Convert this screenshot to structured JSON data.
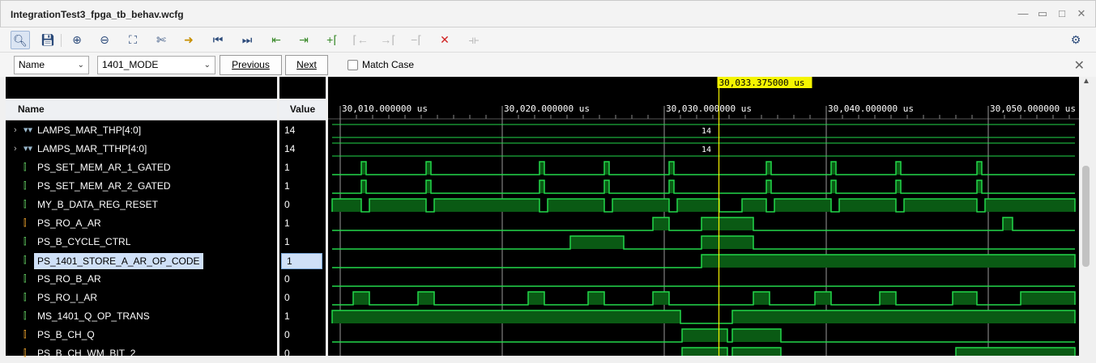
{
  "window": {
    "title": "IntegrationTest3_fpga_tb_behav.wcfg"
  },
  "search": {
    "field": "Name",
    "value": "1401_MODE",
    "previous_label": "Previous",
    "next_label": "Next",
    "match_case_label": "Match Case"
  },
  "columns": {
    "name": "Name",
    "value": "Value"
  },
  "signals": [
    {
      "name": "LAMPS_MAR_THP[4:0]",
      "value": "14",
      "type": "bus"
    },
    {
      "name": "LAMPS_MAR_TTHP[4:0]",
      "value": "14",
      "type": "bus"
    },
    {
      "name": "PS_SET_MEM_AR_1_GATED",
      "value": "1",
      "type": "bit"
    },
    {
      "name": "PS_SET_MEM_AR_2_GATED",
      "value": "1",
      "type": "bit"
    },
    {
      "name": "MY_B_DATA_REG_RESET",
      "value": "0",
      "type": "bit"
    },
    {
      "name": "PS_RO_A_AR",
      "value": "1",
      "type": "bit-orange"
    },
    {
      "name": "PS_B_CYCLE_CTRL",
      "value": "1",
      "type": "bit"
    },
    {
      "name": "PS_1401_STORE_A_AR_OP_CODE",
      "value": "1",
      "type": "bit",
      "selected": true
    },
    {
      "name": "PS_RO_B_AR",
      "value": "0",
      "type": "bit"
    },
    {
      "name": "PS_RO_I_AR",
      "value": "0",
      "type": "bit"
    },
    {
      "name": "MS_1401_Q_OP_TRANS",
      "value": "1",
      "type": "bit"
    },
    {
      "name": "PS_B_CH_Q",
      "value": "0",
      "type": "bit-orange"
    },
    {
      "name": "PS_B_CH_WM_BIT_2",
      "value": "0",
      "type": "bit-orange"
    }
  ],
  "timeline": {
    "cursor_label": "30,033.375000 us",
    "cursor_time_us": 30033.375,
    "ticks": [
      {
        "t": 30010,
        "label": "30,010.000000 us"
      },
      {
        "t": 30020,
        "label": "30,020.000000 us"
      },
      {
        "t": 30030,
        "label": "30,030.000000 us"
      },
      {
        "t": 30040,
        "label": "30,040.000000 us"
      },
      {
        "t": 30050,
        "label": "30,050.000000 us"
      }
    ],
    "bus_values": [
      "14",
      "14"
    ]
  },
  "waves": {
    "PS_SET_MEM_AR_1_GATED": [
      [
        30011.3,
        30011.6
      ],
      [
        30015.3,
        30015.6
      ],
      [
        30022.3,
        30022.6
      ],
      [
        30026.3,
        30026.6
      ],
      [
        30030.3,
        30030.6
      ],
      [
        30036.3,
        30036.6
      ],
      [
        30040.3,
        30040.6
      ],
      [
        30044.3,
        30044.6
      ],
      [
        30049.3,
        30049.6
      ]
    ],
    "PS_SET_MEM_AR_2_GATED": [
      [
        30011.3,
        30011.6
      ],
      [
        30015.3,
        30015.6
      ],
      [
        30022.3,
        30022.6
      ],
      [
        30026.3,
        30026.6
      ],
      [
        30030.3,
        30030.6
      ],
      [
        30036.3,
        30036.6
      ],
      [
        30040.3,
        30040.6
      ],
      [
        30044.3,
        30044.6
      ],
      [
        30049.3,
        30049.6
      ]
    ],
    "MY_B_DATA_REG_RESET": [
      [
        30005.2,
        30011.3
      ],
      [
        30011.8,
        30015.3
      ],
      [
        30015.8,
        30022.3
      ],
      [
        30022.8,
        30026.3
      ],
      [
        30026.8,
        30030.3
      ],
      [
        30030.8,
        30033.4
      ],
      [
        30034.8,
        30036.3
      ],
      [
        30036.8,
        30040.3
      ],
      [
        30040.8,
        30044.3
      ],
      [
        30044.8,
        30049.3
      ],
      [
        30049.8,
        30055.5
      ]
    ],
    "PS_RO_A_AR": [
      [
        30029.3,
        30030.3
      ],
      [
        30032.3,
        30035.5
      ],
      [
        30050.9,
        30051.5
      ]
    ],
    "PS_B_CYCLE_CTRL": [
      [
        30024.2,
        30027.5
      ],
      [
        30032.3,
        30035.5
      ]
    ],
    "PS_1401_STORE_A_AR_OP_CODE": [
      [
        30032.3,
        30055.5
      ]
    ],
    "PS_RO_B_AR": [],
    "PS_RO_I_AR": [
      [
        30010.8,
        30011.8
      ],
      [
        30014.8,
        30015.8
      ],
      [
        30021.6,
        30022.6
      ],
      [
        30025.3,
        30026.3
      ],
      [
        30029.3,
        30030.3
      ],
      [
        30035.5,
        30036.5
      ],
      [
        30039.3,
        30040.3
      ],
      [
        30043.3,
        30044.3
      ],
      [
        30047.8,
        30049.3
      ],
      [
        30052,
        30055.5
      ]
    ],
    "MS_1401_Q_OP_TRANS": [
      [
        30005.2,
        30031
      ],
      [
        30034.2,
        30055.5
      ]
    ],
    "PS_B_CH_Q": [
      [
        30031.1,
        30033.9
      ],
      [
        30034.2,
        30037.2
      ]
    ],
    "PS_B_CH_WM_BIT_2": [
      [
        30031.1,
        30033.9
      ],
      [
        30034.2,
        30037.2
      ],
      [
        30048,
        30055.5
      ]
    ]
  }
}
